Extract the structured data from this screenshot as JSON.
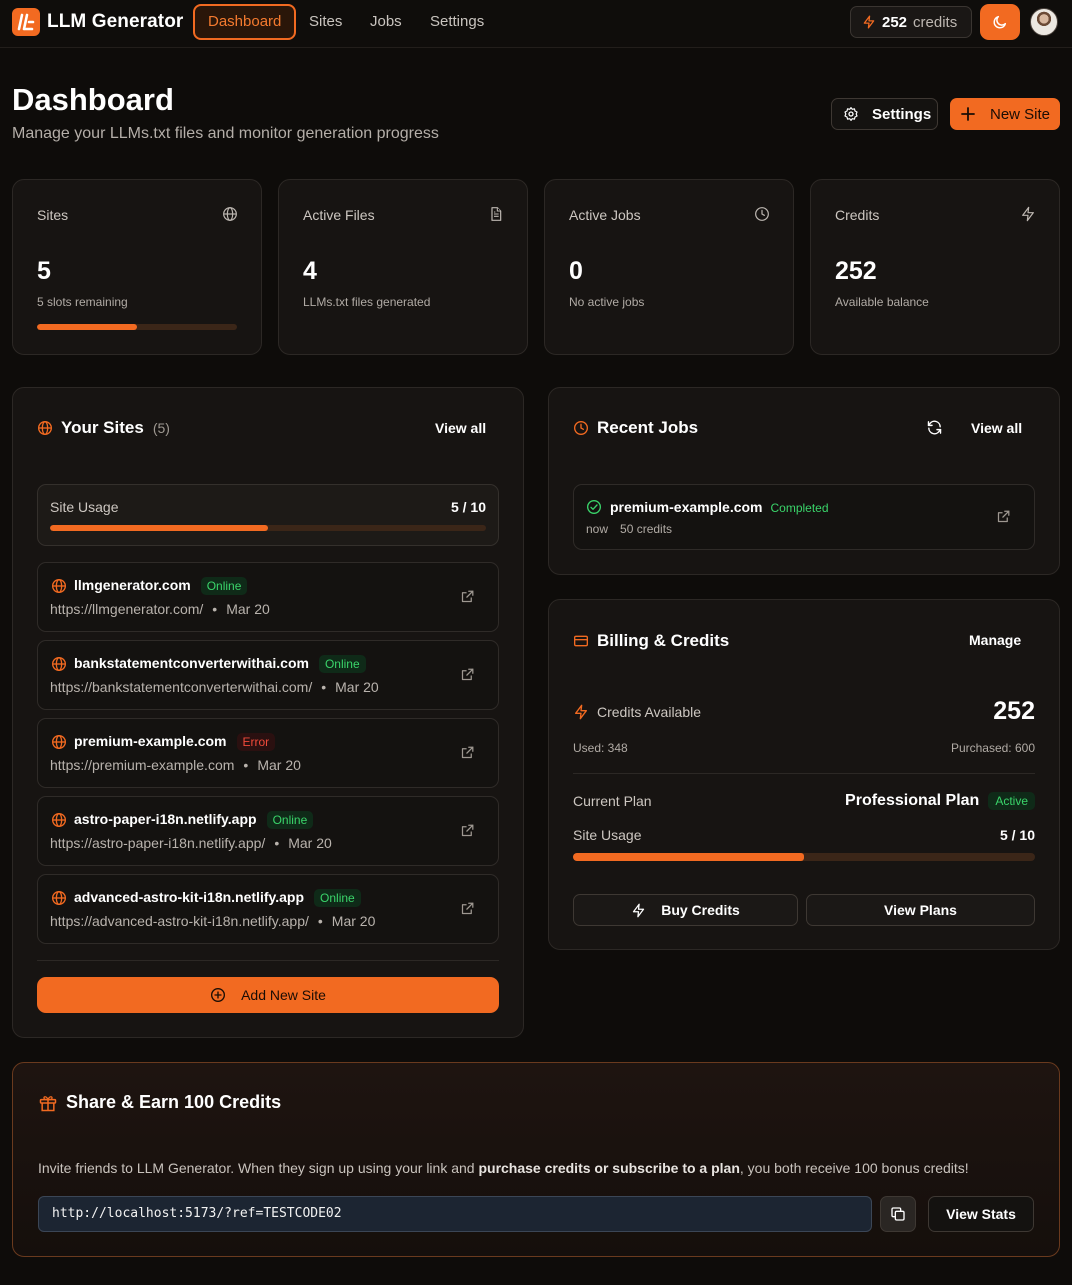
{
  "app": {
    "name": "LLM Generator"
  },
  "nav": {
    "links": [
      {
        "label": "Dashboard",
        "active": true
      },
      {
        "label": "Sites"
      },
      {
        "label": "Jobs"
      },
      {
        "label": "Settings"
      }
    ],
    "credits": {
      "value": "252",
      "label": "credits"
    }
  },
  "header": {
    "title": "Dashboard",
    "subtitle": "Manage your LLMs.txt files and monitor generation progress",
    "settings_label": "Settings",
    "new_site_label": "New Site"
  },
  "stats": [
    {
      "label": "Sites",
      "icon": "globe-icon",
      "value": "5",
      "note": "5 slots remaining",
      "progress": 0.5
    },
    {
      "label": "Active Files",
      "icon": "file-text-icon",
      "value": "4",
      "note": "LLMs.txt files generated"
    },
    {
      "label": "Active Jobs",
      "icon": "clock-icon",
      "value": "0",
      "note": "No active jobs"
    },
    {
      "label": "Credits",
      "icon": "zap-icon",
      "value": "252",
      "note": "Available balance"
    }
  ],
  "sites": {
    "title": "Your Sites",
    "count": "(5)",
    "view_all": "View all",
    "usage_label": "Site Usage",
    "usage_value": "5 / 10",
    "usage_fraction": 0.5,
    "items": [
      {
        "domain": "llmgenerator.com",
        "status": "Online",
        "url": "https://llmgenerator.com/",
        "date": "Mar 20"
      },
      {
        "domain": "bankstatementconverterwithai.com",
        "status": "Online",
        "url": "https://bankstatementconverterwithai.com/",
        "date": "Mar 20"
      },
      {
        "domain": "premium-example.com",
        "status": "Error",
        "url": "https://premium-example.com",
        "date": "Mar 20"
      },
      {
        "domain": "astro-paper-i18n.netlify.app",
        "status": "Online",
        "url": "https://astro-paper-i18n.netlify.app/",
        "date": "Mar 20"
      },
      {
        "domain": "advanced-astro-kit-i18n.netlify.app",
        "status": "Online",
        "url": "https://advanced-astro-kit-i18n.netlify.app/",
        "date": "Mar 20"
      }
    ],
    "separator": "•",
    "add_label": "Add New Site"
  },
  "jobs": {
    "title": "Recent Jobs",
    "view_all": "View all",
    "items": [
      {
        "domain": "premium-example.com",
        "status": "Completed",
        "time": "now",
        "credits": "50 credits"
      }
    ]
  },
  "billing": {
    "title": "Billing & Credits",
    "manage": "Manage",
    "credits_label": "Credits Available",
    "credits_value": "252",
    "used": "Used: 348",
    "purchased": "Purchased: 600",
    "plan_label": "Current Plan",
    "plan_name": "Professional Plan",
    "plan_status": "Active",
    "usage_label": "Site Usage",
    "usage_value": "5 / 10",
    "usage_fraction": 0.5,
    "buy_label": "Buy Credits",
    "plans_label": "View Plans"
  },
  "share": {
    "title": "Share & Earn 100 Credits",
    "text_before": "Invite friends to LLM Generator. When they sign up using your link and ",
    "text_bold": "purchase credits or subscribe to a plan",
    "text_after": ", you both receive 100 bonus credits!",
    "link": "http://localhost:5173/?ref=TESTCODE02",
    "stats_label": "View Stats"
  },
  "colors": {
    "accent": "#f26a21",
    "online": "#3ad46a",
    "error": "#f04a3a"
  }
}
